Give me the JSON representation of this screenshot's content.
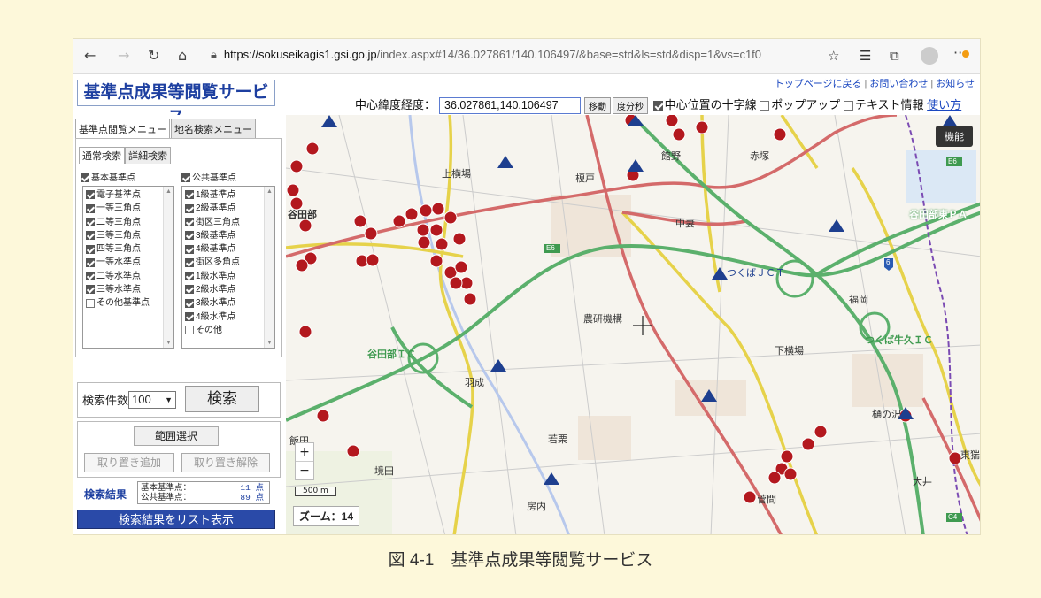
{
  "browser": {
    "url_host": "https://sokuseikagis1.gsi.go.jp",
    "url_path": "/index.aspx#14/36.027861/140.106497/&base=std&ls=std&disp=1&vs=c1f0"
  },
  "header": {
    "logo": "基準点成果等閲覧サービス",
    "links": [
      "トップページに戻る",
      "お問い合わせ",
      "お知らせ"
    ],
    "coord_label": "中心緯度経度：",
    "coord_value": "36.027861,140.106497",
    "move_btn": "移動",
    "dms_btn": "度分秒",
    "opt_cross": "中心位置の十字線",
    "opt_popup": "ポップアップ",
    "opt_text": "テキスト情報",
    "help_link": "使い方"
  },
  "left": {
    "tabs": [
      "基準点閲覧メニュー",
      "地名検索メニュー"
    ],
    "subtabs": [
      "通常検索",
      "詳細検索"
    ],
    "group1": {
      "title": "基本基準点",
      "items": [
        "電子基準点",
        "一等三角点",
        "二等三角点",
        "三等三角点",
        "四等三角点",
        "一等水準点",
        "二等水準点",
        "三等水準点",
        "その他基準点"
      ]
    },
    "group2": {
      "title": "公共基準点",
      "items": [
        "1級基準点",
        "2級基準点",
        "街区三角点",
        "3級基準点",
        "4級基準点",
        "街区多角点",
        "1級水準点",
        "2級水準点",
        "3級水準点",
        "4級水準点",
        "その他"
      ]
    },
    "count_label": "検索件数",
    "count_value": "100",
    "search_btn": "検索",
    "range_btn": "範囲選択",
    "keep_add": "取り置き追加",
    "keep_remove": "取り置き解除",
    "results_label": "検索結果",
    "res1_label": "基本基準点：",
    "res1_value": "11 点",
    "res2_label": "公共基準点：",
    "res2_value": "89 点",
    "list_btn": "検索結果をリスト表示"
  },
  "map": {
    "func_btn": "機能",
    "zoom_in": "+",
    "zoom_out": "−",
    "scale": "500 m",
    "zoom_label": "ズーム：14",
    "places": [
      "上横場",
      "榎戸",
      "館野",
      "赤塚",
      "谷田部",
      "中妻",
      "谷田部東ＰＡ",
      "つくばＪＣＴ",
      "福岡",
      "谷田部ＩＣ",
      "農研機構",
      "下横場",
      "つくば牛久ＩＣ",
      "羽成",
      "若栗",
      "樋の沢",
      "飯田",
      "境田",
      "房内",
      "菅間",
      "東猯穴",
      "大井",
      "E6",
      "E6",
      "C4",
      "6"
    ]
  },
  "caption": "図 4-1　基準点成果等閲覧サービス"
}
